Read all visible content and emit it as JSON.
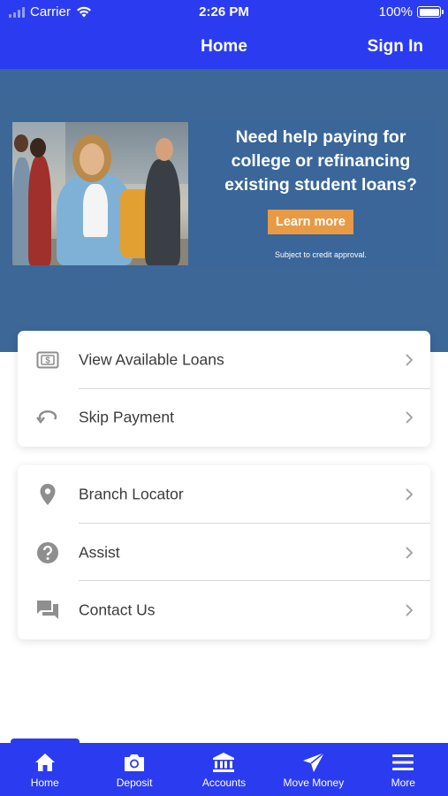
{
  "status_bar": {
    "carrier": "Carrier",
    "time": "2:26 PM",
    "battery": "100%"
  },
  "nav": {
    "title": "Home",
    "sign_in": "Sign In"
  },
  "banner": {
    "headline_line1": "Need help paying for",
    "headline_line2": "college or refinancing",
    "headline_line3": "existing student loans?",
    "button": "Learn more",
    "disclaimer": "Subject to credit approval."
  },
  "card1": {
    "items": [
      {
        "label": "View Available Loans",
        "icon": "dollar-bill-icon"
      },
      {
        "label": "Skip Payment",
        "icon": "skip-arrow-icon"
      }
    ]
  },
  "card2": {
    "items": [
      {
        "label": "Branch Locator",
        "icon": "location-pin-icon"
      },
      {
        "label": "Assist",
        "icon": "help-icon"
      },
      {
        "label": "Contact Us",
        "icon": "chat-icon"
      }
    ]
  },
  "tabs": [
    {
      "label": "Home",
      "icon": "home-icon"
    },
    {
      "label": "Deposit",
      "icon": "camera-icon"
    },
    {
      "label": "Accounts",
      "icon": "bank-icon"
    },
    {
      "label": "Move Money",
      "icon": "paper-plane-icon"
    },
    {
      "label": "More",
      "icon": "menu-icon"
    }
  ],
  "colors": {
    "primary": "#2b3cf0",
    "banner_bg": "#3c6797",
    "accent": "#e89a45",
    "icon_gray": "#8e8e8e"
  }
}
